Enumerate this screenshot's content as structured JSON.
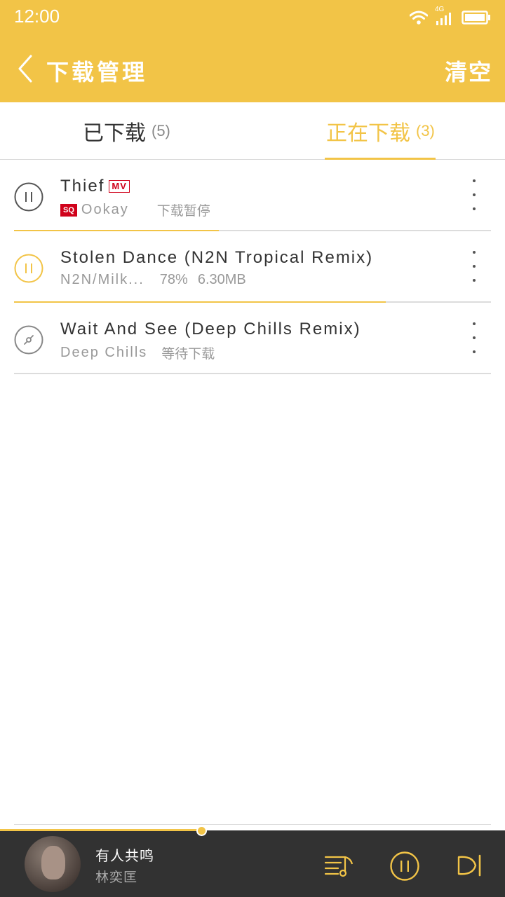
{
  "status_bar": {
    "time": "12:00",
    "network": "4G"
  },
  "header": {
    "title": "下载管理",
    "clear_label": "清空"
  },
  "tabs": [
    {
      "label": "已下载",
      "count": "(5)",
      "active": false
    },
    {
      "label": "正在下载",
      "count": "(3)",
      "active": true
    }
  ],
  "downloads": [
    {
      "title": "Thief",
      "mv_badge": "MV",
      "sq_badge": "SQ",
      "artist": "Ookay",
      "status": "下载暂停",
      "progress": 0.43,
      "state": "paused"
    },
    {
      "title": "Stolen Dance (N2N Tropical Remix)",
      "artist": "N2N/Milk...",
      "percent": "78%",
      "size": "6.30MB",
      "progress": 0.78,
      "state": "downloading"
    },
    {
      "title": "Wait And See (Deep Chills Remix)",
      "artist": "Deep Chills",
      "status": "等待下载",
      "progress": 0,
      "state": "waiting"
    }
  ],
  "player": {
    "song": "有人共鸣",
    "artist": "林奕匡",
    "progress": 0.4
  },
  "colors": {
    "accent": "#f2c447",
    "badge_red": "#d0021b",
    "player_bg": "#323232"
  }
}
